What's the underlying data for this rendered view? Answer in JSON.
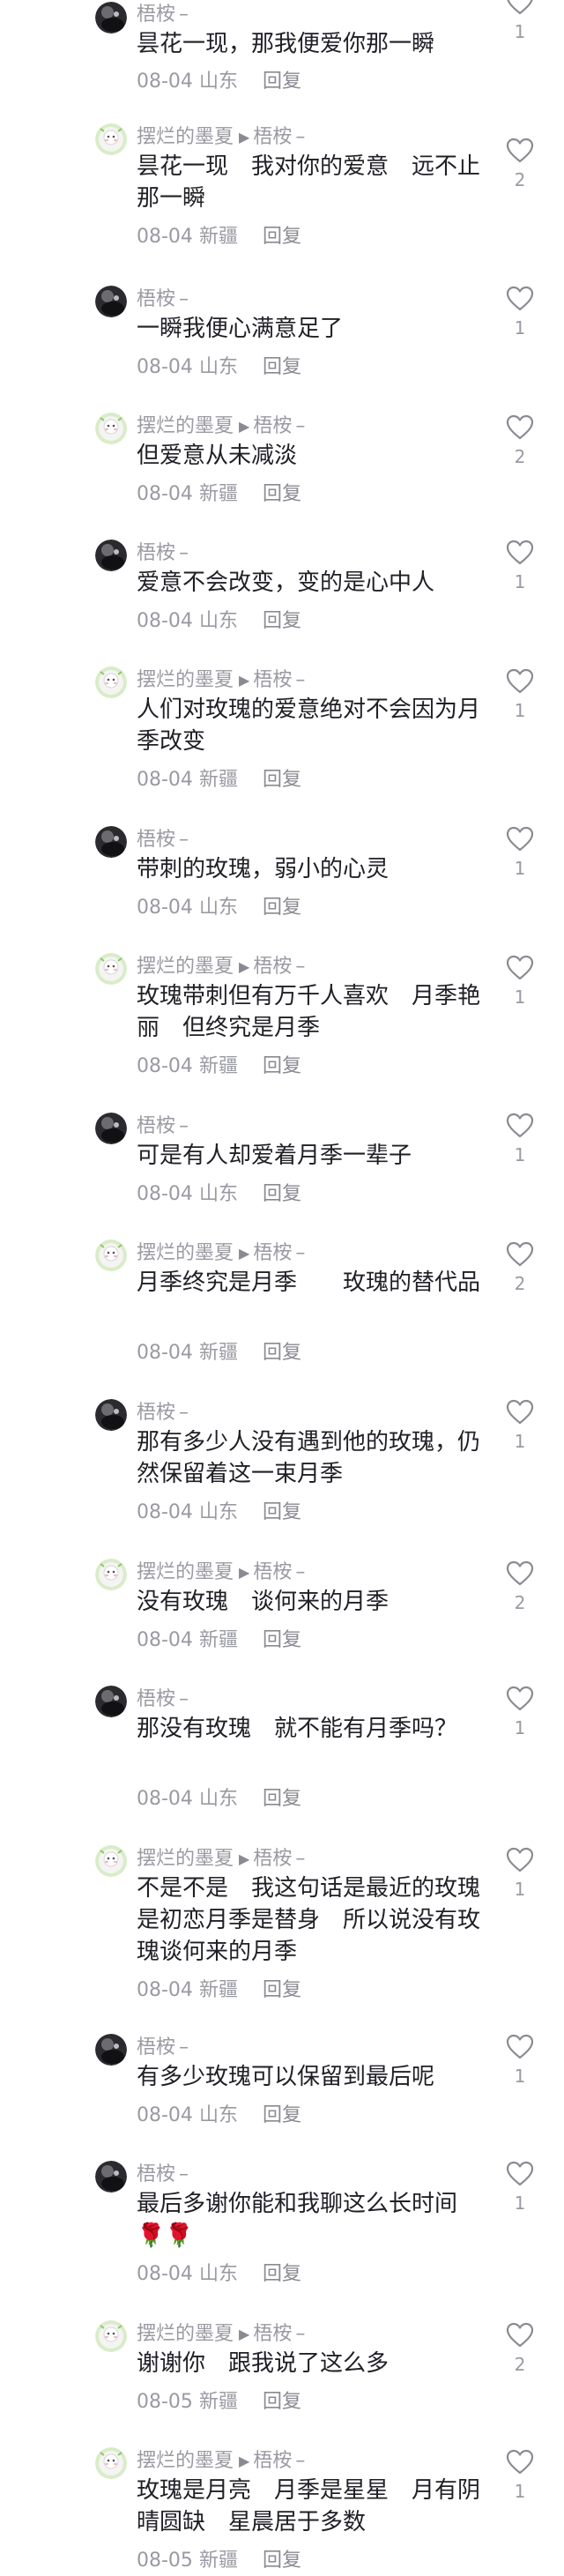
{
  "comments": [
    {
      "author": "梧桉",
      "reply_to": "",
      "text": "昙花一现，那我便爱你那一瞬",
      "date": "08-04",
      "location": "山东",
      "likes": "1",
      "avatar": "dark"
    },
    {
      "author": "摆烂的墨夏",
      "reply_to": "梧桉",
      "text": "昙花一现　我对你的爱意　远不止那一瞬",
      "date": "08-04",
      "location": "新疆",
      "likes": "2",
      "avatar": "light"
    },
    {
      "author": "梧桉",
      "reply_to": "",
      "text": "一瞬我便心满意足了",
      "date": "08-04",
      "location": "山东",
      "likes": "1",
      "avatar": "dark"
    },
    {
      "author": "摆烂的墨夏",
      "reply_to": "梧桉",
      "text": "但爱意从未减淡",
      "date": "08-04",
      "location": "新疆",
      "likes": "2",
      "avatar": "light"
    },
    {
      "author": "梧桉",
      "reply_to": "",
      "text": "爱意不会改变，变的是心中人",
      "date": "08-04",
      "location": "山东",
      "likes": "1",
      "avatar": "dark"
    },
    {
      "author": "摆烂的墨夏",
      "reply_to": "梧桉",
      "text": "人们对玫瑰的爱意绝对不会因为月季改变",
      "date": "08-04",
      "location": "新疆",
      "likes": "1",
      "avatar": "light"
    },
    {
      "author": "梧桉",
      "reply_to": "",
      "text": "带刺的玫瑰，弱小的心灵",
      "date": "08-04",
      "location": "山东",
      "likes": "1",
      "avatar": "dark"
    },
    {
      "author": "摆烂的墨夏",
      "reply_to": "梧桉",
      "text": "玫瑰带刺但有万千人喜欢　月季艳丽　但终究是月季",
      "date": "08-04",
      "location": "新疆",
      "likes": "1",
      "avatar": "light"
    },
    {
      "author": "梧桉",
      "reply_to": "",
      "text": "可是有人却爱着月季一辈子",
      "date": "08-04",
      "location": "山东",
      "likes": "1",
      "avatar": "dark"
    },
    {
      "author": "摆烂的墨夏",
      "reply_to": "梧桉",
      "text": "月季终究是月季　　玫瑰的替代品",
      "date": "08-04",
      "location": "新疆",
      "likes": "2",
      "avatar": "light"
    },
    {
      "author": "梧桉",
      "reply_to": "",
      "text": "那有多少人没有遇到他的玫瑰，仍然保留着这一束月季",
      "date": "08-04",
      "location": "山东",
      "likes": "1",
      "avatar": "dark"
    },
    {
      "author": "摆烂的墨夏",
      "reply_to": "梧桉",
      "text": "没有玫瑰　谈何来的月季",
      "date": "08-04",
      "location": "新疆",
      "likes": "2",
      "avatar": "light"
    },
    {
      "author": "梧桉",
      "reply_to": "",
      "text": "那没有玫瑰　就不能有月季吗？",
      "date": "08-04",
      "location": "山东",
      "likes": "1",
      "avatar": "dark"
    },
    {
      "author": "摆烂的墨夏",
      "reply_to": "梧桉",
      "text": "不是不是　我这句话是最近的玫瑰是初恋月季是替身　所以说没有玫瑰谈何来的月季",
      "date": "08-04",
      "location": "新疆",
      "likes": "1",
      "avatar": "light"
    },
    {
      "author": "梧桉",
      "reply_to": "",
      "text": "有多少玫瑰可以保留到最后呢",
      "date": "08-04",
      "location": "山东",
      "likes": "1",
      "avatar": "dark"
    },
    {
      "author": "梧桉",
      "reply_to": "",
      "text": "最后多谢你能和我聊这么长时间🌹🌹",
      "date": "08-04",
      "location": "山东",
      "likes": "1",
      "avatar": "dark"
    },
    {
      "author": "摆烂的墨夏",
      "reply_to": "梧桉",
      "text": "谢谢你　跟我说了这么多",
      "date": "08-05",
      "location": "新疆",
      "likes": "2",
      "avatar": "light"
    },
    {
      "author": "摆烂的墨夏",
      "reply_to": "梧桉",
      "text": "玫瑰是月亮　月季是星星　月有阴晴圆缺　星晨居于多数",
      "date": "08-05",
      "location": "新疆",
      "likes": "1",
      "avatar": "light"
    }
  ],
  "labels": {
    "reply": "回复",
    "author_suffix": "–",
    "reply_arrow": "▶"
  },
  "colors": {
    "meta_text": "#9a9aa3",
    "body_text": "#1f1f26",
    "icon_stroke": "#8a8a92",
    "background": "#ffffff"
  }
}
